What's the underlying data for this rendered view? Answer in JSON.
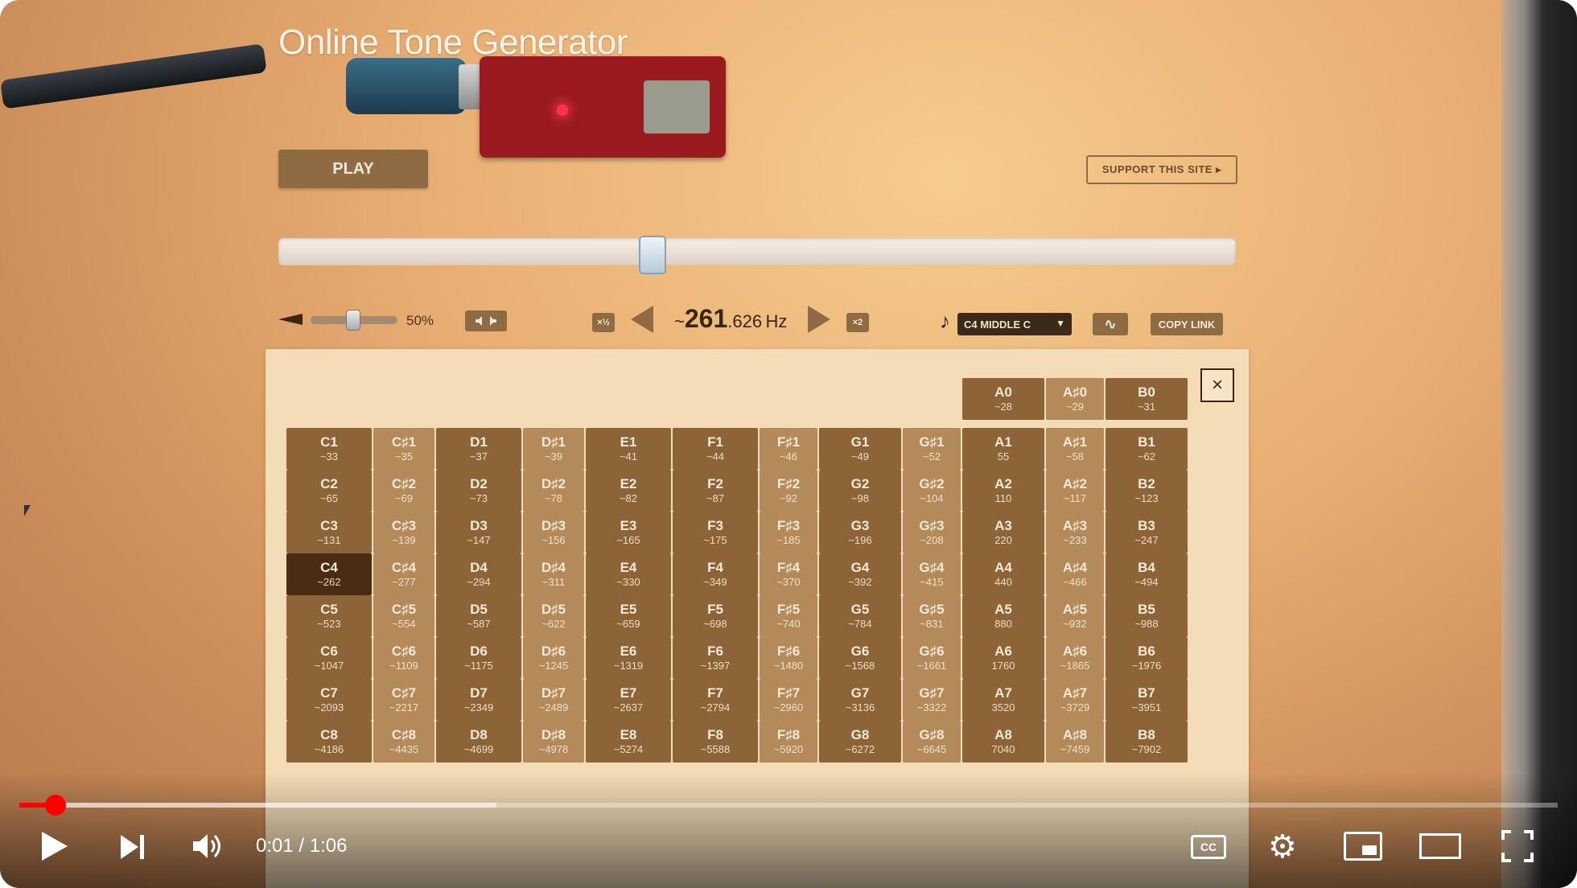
{
  "app": {
    "title": "Online Tone Generator",
    "play_label": "PLAY",
    "support_label": "SUPPORT THIS SITE ▸",
    "slider_position": 0.38,
    "volume_level": 0.5
  },
  "controls": {
    "volume_text": "50%",
    "half_label": "×½",
    "double_label": "×2",
    "freq_prefix": "~",
    "freq_int": "261",
    "freq_dec": ".626",
    "freq_unit": "Hz",
    "note_icon": "♪",
    "note_select_value": "C4 MIDDLE C",
    "wave_icon": "∿",
    "copy_link_label": "COPY LINK",
    "close_label": "×"
  },
  "note_rows": [
    [
      [
        "A0",
        "~28"
      ],
      [
        "A♯0",
        "~29"
      ],
      [
        "B0",
        "~31"
      ]
    ],
    [
      [
        "C1",
        "~33"
      ],
      [
        "C♯1",
        "~35"
      ],
      [
        "D1",
        "~37"
      ],
      [
        "D♯1",
        "~39"
      ],
      [
        "E1",
        "~41"
      ],
      [
        "F1",
        "~44"
      ],
      [
        "F♯1",
        "~46"
      ],
      [
        "G1",
        "~49"
      ],
      [
        "G♯1",
        "~52"
      ],
      [
        "A1",
        "55"
      ],
      [
        "A♯1",
        "~58"
      ],
      [
        "B1",
        "~62"
      ]
    ],
    [
      [
        "C2",
        "~65"
      ],
      [
        "C♯2",
        "~69"
      ],
      [
        "D2",
        "~73"
      ],
      [
        "D♯2",
        "~78"
      ],
      [
        "E2",
        "~82"
      ],
      [
        "F2",
        "~87"
      ],
      [
        "F♯2",
        "~92"
      ],
      [
        "G2",
        "~98"
      ],
      [
        "G♯2",
        "~104"
      ],
      [
        "A2",
        "110"
      ],
      [
        "A♯2",
        "~117"
      ],
      [
        "B2",
        "~123"
      ]
    ],
    [
      [
        "C3",
        "~131"
      ],
      [
        "C♯3",
        "~139"
      ],
      [
        "D3",
        "~147"
      ],
      [
        "D♯3",
        "~156"
      ],
      [
        "E3",
        "~165"
      ],
      [
        "F3",
        "~175"
      ],
      [
        "F♯3",
        "~185"
      ],
      [
        "G3",
        "~196"
      ],
      [
        "G♯3",
        "~208"
      ],
      [
        "A3",
        "220"
      ],
      [
        "A♯3",
        "~233"
      ],
      [
        "B3",
        "~247"
      ]
    ],
    [
      [
        "C4",
        "~262"
      ],
      [
        "C♯4",
        "~277"
      ],
      [
        "D4",
        "~294"
      ],
      [
        "D♯4",
        "~311"
      ],
      [
        "E4",
        "~330"
      ],
      [
        "F4",
        "~349"
      ],
      [
        "F♯4",
        "~370"
      ],
      [
        "G4",
        "~392"
      ],
      [
        "G♯4",
        "~415"
      ],
      [
        "A4",
        "440"
      ],
      [
        "A♯4",
        "~466"
      ],
      [
        "B4",
        "~494"
      ]
    ],
    [
      [
        "C5",
        "~523"
      ],
      [
        "C♯5",
        "~554"
      ],
      [
        "D5",
        "~587"
      ],
      [
        "D♯5",
        "~622"
      ],
      [
        "E5",
        "~659"
      ],
      [
        "F5",
        "~698"
      ],
      [
        "F♯5",
        "~740"
      ],
      [
        "G5",
        "~784"
      ],
      [
        "G♯5",
        "~831"
      ],
      [
        "A5",
        "880"
      ],
      [
        "A♯5",
        "~932"
      ],
      [
        "B5",
        "~988"
      ]
    ],
    [
      [
        "C6",
        "~1047"
      ],
      [
        "C♯6",
        "~1109"
      ],
      [
        "D6",
        "~1175"
      ],
      [
        "D♯6",
        "~1245"
      ],
      [
        "E6",
        "~1319"
      ],
      [
        "F6",
        "~1397"
      ],
      [
        "F♯6",
        "~1480"
      ],
      [
        "G6",
        "~1568"
      ],
      [
        "G♯6",
        "~1661"
      ],
      [
        "A6",
        "1760"
      ],
      [
        "A♯6",
        "~1865"
      ],
      [
        "B6",
        "~1976"
      ]
    ],
    [
      [
        "C7",
        "~2093"
      ],
      [
        "C♯7",
        "~2217"
      ],
      [
        "D7",
        "~2349"
      ],
      [
        "D♯7",
        "~2489"
      ],
      [
        "E7",
        "~2637"
      ],
      [
        "F7",
        "~2794"
      ],
      [
        "F♯7",
        "~2960"
      ],
      [
        "G7",
        "~3136"
      ],
      [
        "G♯7",
        "~3322"
      ],
      [
        "A7",
        "3520"
      ],
      [
        "A♯7",
        "~3729"
      ],
      [
        "B7",
        "~3951"
      ]
    ],
    [
      [
        "C8",
        "~4186"
      ],
      [
        "C♯8",
        "~4435"
      ],
      [
        "D8",
        "~4699"
      ],
      [
        "D♯8",
        "~4978"
      ],
      [
        "E8",
        "~5274"
      ],
      [
        "F8",
        "~5588"
      ],
      [
        "F♯8",
        "~5920"
      ],
      [
        "G8",
        "~6272"
      ],
      [
        "G♯8",
        "~6645"
      ],
      [
        "A8",
        "7040"
      ],
      [
        "A♯8",
        "~7459"
      ],
      [
        "B8",
        "~7902"
      ]
    ]
  ],
  "active_note": "C4",
  "player": {
    "time_text": "0:01 / 1:06",
    "cc_label": "CC",
    "settings_icon": "⚙",
    "progress_played": 0.015,
    "progress_buffered": 0.31
  }
}
